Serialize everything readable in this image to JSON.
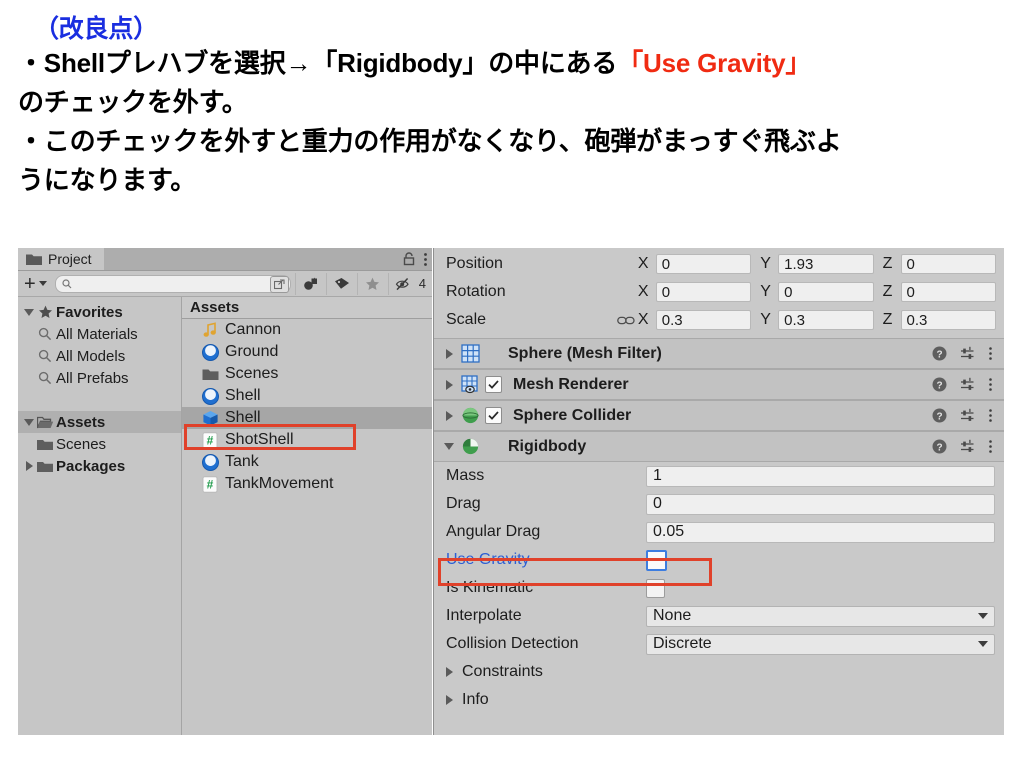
{
  "document_text": {
    "heading": "（改良点）",
    "line1_pre": "・Shellプレハブを選択→「Rigidbody」の中にある",
    "line1_hl": "「Use Gravity」",
    "line2": "のチェックを外す。",
    "line3": "・このチェックを外すと重力の作用がなくなり、砲弾がまっすぐ飛ぶよ",
    "line4": "うになります。",
    "heading_color": "#1a2ee0",
    "highlight_color": "#f02b12"
  },
  "project_panel": {
    "tab_label": "Project",
    "tab_icon": "folder-icon",
    "lock_icon": "lock-icon",
    "menu_icon": "kebab-menu-icon",
    "toolbar": {
      "create_label": "+",
      "search_placeholder": "",
      "search_value": "",
      "search_icon": "magnifier-icon",
      "save_search_icon": "save-search-icon",
      "type_filter_icon": "object-filter-icon",
      "label_filter_icon": "tag-icon",
      "favorite_icon": "star-icon",
      "hidden_icon": "eye-slash-icon",
      "hidden_count": "4"
    },
    "tree": [
      {
        "label": "Favorites",
        "icon": "star-icon",
        "expander": "down",
        "bold": true,
        "indent": 0,
        "selected": false
      },
      {
        "label": "All Materials",
        "icon": "magnifier-icon",
        "expander": "none",
        "bold": false,
        "indent": 1,
        "selected": false
      },
      {
        "label": "All Models",
        "icon": "magnifier-icon",
        "expander": "none",
        "bold": false,
        "indent": 1,
        "selected": false
      },
      {
        "label": "All Prefabs",
        "icon": "magnifier-icon",
        "expander": "none",
        "bold": false,
        "indent": 1,
        "selected": false
      },
      {
        "label": "",
        "icon": "none",
        "expander": "none",
        "bold": false,
        "indent": 0,
        "selected": false
      },
      {
        "label": "Assets",
        "icon": "open-folder-icon",
        "expander": "down",
        "bold": true,
        "indent": 0,
        "selected": true
      },
      {
        "label": "Scenes",
        "icon": "folder-icon",
        "expander": "none",
        "bold": false,
        "indent": 1,
        "selected": false
      },
      {
        "label": "Packages",
        "icon": "folder-icon",
        "expander": "right",
        "bold": true,
        "indent": 0,
        "selected": false
      }
    ],
    "assets_header": "Assets",
    "assets": [
      {
        "label": "Cannon",
        "icon": "audio-clip-icon",
        "selected": false
      },
      {
        "label": "Ground",
        "icon": "material-icon",
        "selected": false
      },
      {
        "label": "Scenes",
        "icon": "folder-icon",
        "selected": false
      },
      {
        "label": "Shell",
        "icon": "material-icon",
        "selected": false
      },
      {
        "label": "Shell",
        "icon": "prefab-icon",
        "selected": true
      },
      {
        "label": "ShotShell",
        "icon": "csharp-script-icon",
        "selected": false
      },
      {
        "label": "Tank",
        "icon": "material-icon",
        "selected": false
      },
      {
        "label": "TankMovement",
        "icon": "csharp-script-icon",
        "selected": false
      }
    ]
  },
  "inspector": {
    "transform": {
      "rows": [
        {
          "label": "Position",
          "link": false,
          "x": "0",
          "y": "1.93",
          "z": "0"
        },
        {
          "label": "Rotation",
          "link": false,
          "x": "0",
          "y": "0",
          "z": "0"
        },
        {
          "label": "Scale",
          "link": true,
          "x": "0.3",
          "y": "0.3",
          "z": "0.3"
        }
      ],
      "axis_x": "X",
      "axis_y": "Y",
      "axis_z": "Z",
      "link_icon": "constrain-proportions-icon"
    },
    "components": [
      {
        "name": "Sphere (Mesh Filter)",
        "icon": "mesh-filter-icon",
        "expanded": false,
        "has_checkbox": false,
        "checked": false
      },
      {
        "name": "Mesh Renderer",
        "icon": "mesh-renderer-icon",
        "expanded": false,
        "has_checkbox": true,
        "checked": true
      },
      {
        "name": "Sphere Collider",
        "icon": "sphere-collider-icon",
        "expanded": false,
        "has_checkbox": true,
        "checked": true
      },
      {
        "name": "Rigidbody",
        "icon": "rigidbody-icon",
        "expanded": true,
        "has_checkbox": false,
        "checked": false
      }
    ],
    "component_actions": {
      "help_icon": "help-icon",
      "preset_icon": "preset-icon",
      "menu_icon": "kebab-menu-icon"
    },
    "rigidbody_props": [
      {
        "label": "Mass",
        "type": "text",
        "value": "1",
        "highlighted": false
      },
      {
        "label": "Drag",
        "type": "text",
        "value": "0",
        "highlighted": false
      },
      {
        "label": "Angular Drag",
        "type": "text",
        "value": "0.05",
        "highlighted": false
      },
      {
        "label": "Use Gravity",
        "type": "checkbox",
        "value": "unchecked",
        "highlighted": true
      },
      {
        "label": "Is Kinematic",
        "type": "checkbox",
        "value": "unchecked",
        "highlighted": false
      },
      {
        "label": "Interpolate",
        "type": "dropdown",
        "value": "None",
        "highlighted": false
      },
      {
        "label": "Collision Detection",
        "type": "dropdown",
        "value": "Discrete",
        "highlighted": false
      }
    ],
    "foldouts": [
      {
        "label": "Constraints",
        "expander": "right"
      },
      {
        "label": "Info",
        "expander": "right"
      }
    ]
  },
  "annotation": {
    "box_color": "#e0412a",
    "targets": [
      "asset-shell-prefab-row",
      "use-gravity-property-row"
    ]
  }
}
